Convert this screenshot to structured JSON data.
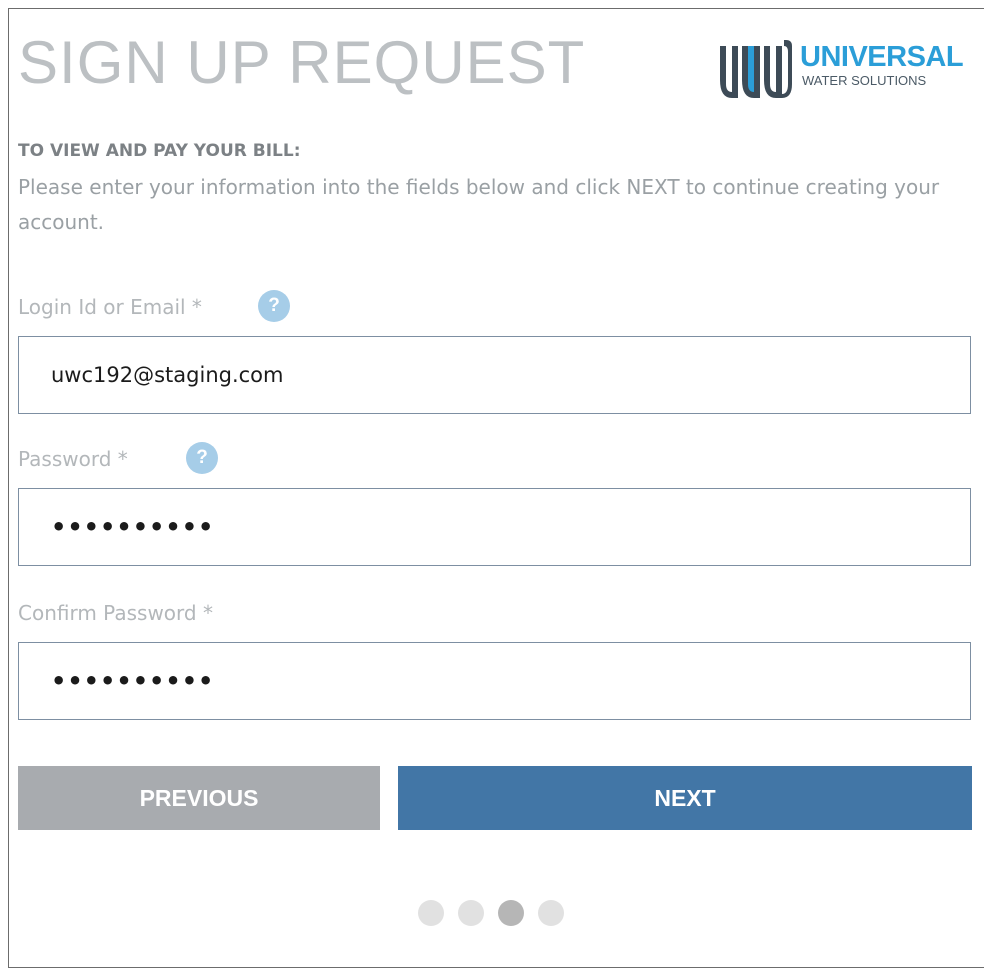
{
  "header": {
    "title": "SIGN UP REQUEST",
    "logo": {
      "name": "UNIVERSAL",
      "tagline": "WATER SOLUTIONS",
      "brand_color": "#2b9ed8",
      "mark_color": "#3d4b57"
    }
  },
  "intro": {
    "heading": "TO VIEW AND PAY YOUR BILL:",
    "text": "Please enter your information into the fields below and click NEXT to continue creating your account."
  },
  "form": {
    "login": {
      "label": "Login Id or Email *",
      "value": "uwc192@staging.com",
      "help_icon": "question-mark-icon"
    },
    "password": {
      "label": "Password *",
      "value": "••••••••••",
      "help_icon": "question-mark-icon"
    },
    "confirm_password": {
      "label": "Confirm Password *",
      "value": "••••••••••"
    }
  },
  "buttons": {
    "previous": "PREVIOUS",
    "next": "NEXT",
    "previous_color": "#a8abaf",
    "next_color": "#4276a6"
  },
  "steps": {
    "total": 4,
    "current": 3
  },
  "colors": {
    "help_icon": "#a6cde8",
    "field_border": "#7d8fa2"
  }
}
